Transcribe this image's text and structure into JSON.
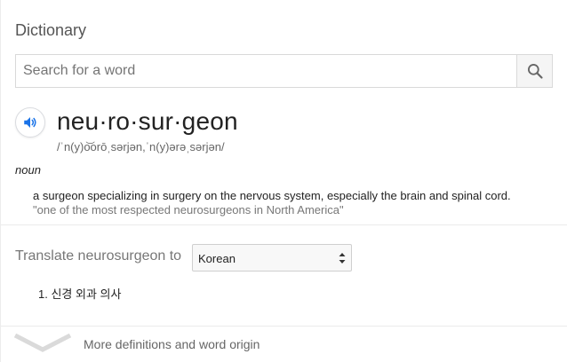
{
  "panel": {
    "title": "Dictionary"
  },
  "search": {
    "placeholder": "Search for a word",
    "value": ""
  },
  "entry": {
    "word": "neu·ro·sur·geon",
    "pronunciation": "/ˈn(y)o͝orōˌsərjən,ˈn(y)ərəˌsərjən/",
    "part_of_speech": "noun",
    "definition": "a surgeon specializing in surgery on the nervous system, especially the brain and spinal cord.",
    "example": "\"one of the most respected neurosurgeons in North America\""
  },
  "translate": {
    "label": "Translate neurosurgeon to",
    "selected_language": "Korean",
    "results": [
      "1. 신경 외과 의사"
    ]
  },
  "footer": {
    "more_label": "More definitions and word origin"
  },
  "colors": {
    "speaker_blue": "#1a73e8",
    "divider": "#ebebeb"
  },
  "icons": {
    "search": "search-icon",
    "speaker": "speaker-icon",
    "select": "select-arrows-icon",
    "expand": "chevron-down-icon"
  }
}
